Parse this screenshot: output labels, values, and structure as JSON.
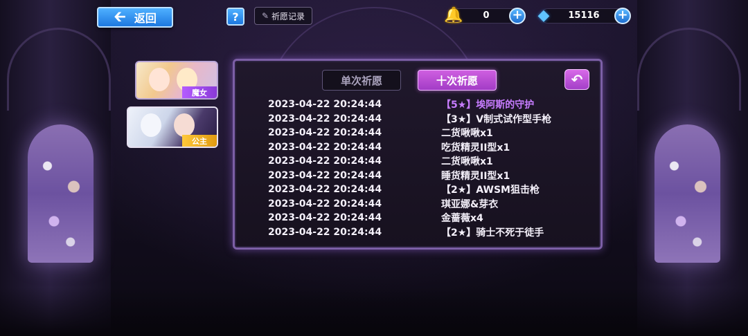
{
  "top_bar": {
    "back_label": "返回",
    "back_icon": "arrow-left-icon",
    "help_label": "?",
    "record_label": "祈愿记录",
    "record_icon": "scroll-icon"
  },
  "currencies": [
    {
      "name": "bell",
      "icon": "bell-icon",
      "value": "0"
    },
    {
      "name": "gem",
      "icon": "gem-icon",
      "value": "15116"
    }
  ],
  "cards": [
    {
      "tag": "魔女",
      "tag_color": "#b45cff"
    },
    {
      "tag": "公主",
      "tag_color": "#ffc83a"
    }
  ],
  "panel": {
    "tabs": [
      {
        "label": "单次祈愿",
        "active": false
      },
      {
        "label": "十次祈愿",
        "active": true
      }
    ],
    "return_icon": "return-arrow-icon",
    "records": [
      {
        "time": "2023-04-22 20:24:44",
        "item": "【5★】埃阿斯的守护",
        "rare": true
      },
      {
        "time": "2023-04-22 20:24:44",
        "item": "【3★】V制式试作型手枪",
        "rare": false
      },
      {
        "time": "2023-04-22 20:24:44",
        "item": "二货啾啾x1",
        "rare": false
      },
      {
        "time": "2023-04-22 20:24:44",
        "item": "吃货精灵II型x1",
        "rare": false
      },
      {
        "time": "2023-04-22 20:24:44",
        "item": "二货啾啾x1",
        "rare": false
      },
      {
        "time": "2023-04-22 20:24:44",
        "item": "睡货精灵II型x1",
        "rare": false
      },
      {
        "time": "2023-04-22 20:24:44",
        "item": "【2★】AWSM狙击枪",
        "rare": false
      },
      {
        "time": "2023-04-22 20:24:44",
        "item": "琪亚娜&芽衣",
        "rare": false
      },
      {
        "time": "2023-04-22 20:24:44",
        "item": "金蔷薇x4",
        "rare": false
      },
      {
        "time": "2023-04-22 20:24:44",
        "item": "【2★】骑士不死于徒手",
        "rare": false
      }
    ]
  },
  "colors": {
    "accent_purple": "#a23cc6",
    "rare_text": "#c77cff",
    "button_blue": "#1d78e0"
  }
}
